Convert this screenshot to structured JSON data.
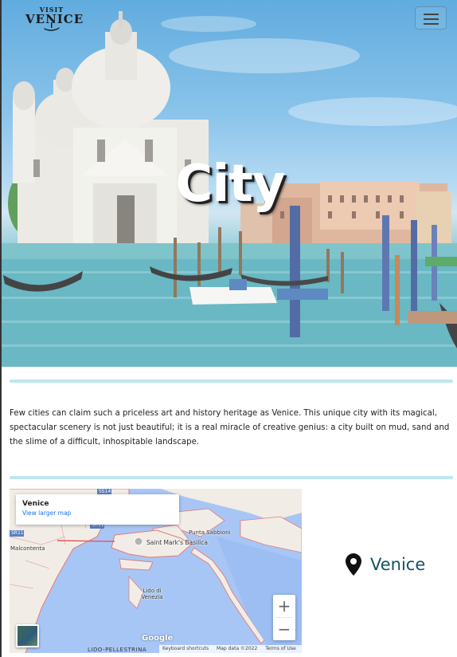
{
  "header": {
    "logo_top": "VISIT",
    "logo_bottom": "VENICE",
    "menu_icon": "hamburger-icon"
  },
  "hero": {
    "title": "City"
  },
  "intro": {
    "text": "Few cities can claim such a priceless art and history heritage as Venice. This unique city with its magical, spectacular scenery is not just beautiful; it is a real miracle of creative genius: a city built on mud, sand and the slime of a difficult, inhospitable landscape."
  },
  "map": {
    "place_name": "Venice",
    "larger_map_link": "View larger map",
    "zoom_in": "+",
    "zoom_out": "−",
    "labels": {
      "malcontenta": "Malcontenta",
      "punta_sabbioni": "Punta Sabbioni",
      "saint_marks": "Saint Mark's Basilica",
      "lido": "Lido di Venezia",
      "lido_pellestrina": "LIDO-PELLESTRINA",
      "sr11": "SR11",
      "ss14": "SS14",
      "sr11b": "SR11"
    },
    "brand": "Google",
    "footer": {
      "shortcuts": "Keyboard shortcuts",
      "data": "Map data ©2022",
      "terms": "Terms of Use"
    }
  },
  "location": {
    "label": "Venice",
    "icon": "map-pin-icon"
  },
  "colors": {
    "divider": "#bfe6ee",
    "location_text": "#13525f",
    "link": "#1a73e8"
  }
}
